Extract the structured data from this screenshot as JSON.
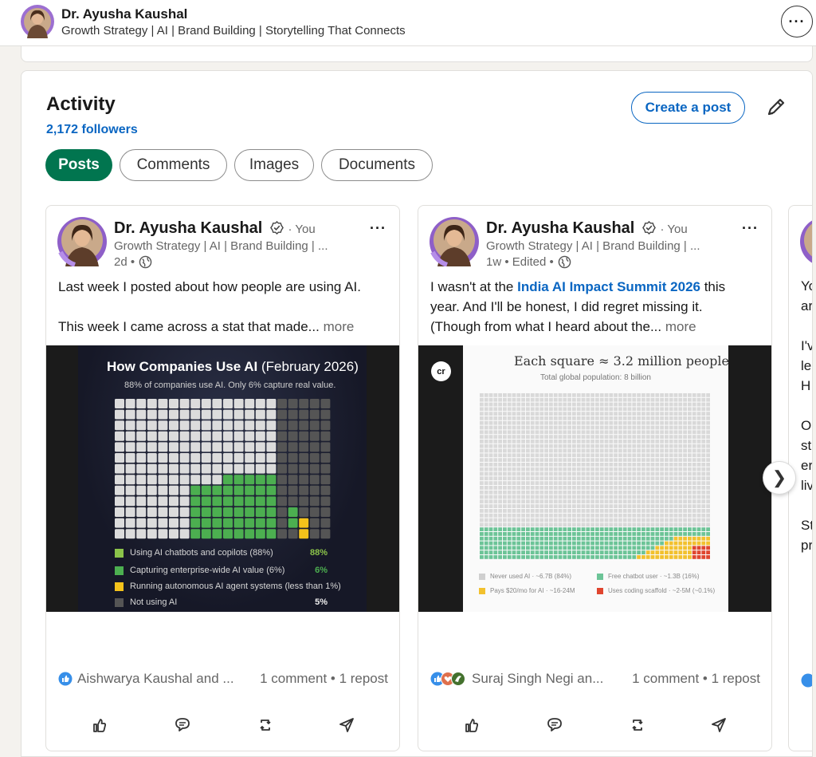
{
  "header": {
    "name": "Dr. Ayusha Kaushal",
    "headline": "Growth Strategy | AI | Brand Building | Storytelling That Connects",
    "more_label": "···"
  },
  "activity": {
    "title": "Activity",
    "followers": "2,172 followers",
    "create_post": "Create a post",
    "tabs": [
      {
        "label": "Posts",
        "active": true
      },
      {
        "label": "Comments",
        "active": false
      },
      {
        "label": "Images",
        "active": false
      },
      {
        "label": "Documents",
        "active": false
      }
    ]
  },
  "posts": [
    {
      "author": "Dr. Ayusha Kaushal",
      "you": "· You",
      "headline": "Growth Strategy | AI | Brand Building | ...",
      "meta": "2d •",
      "menu": "···",
      "text_line1": "Last week I posted about how people are using AI.",
      "text_line2": "This week I came across a stat that made...",
      "more": "more",
      "image": {
        "title": "How Companies Use AI",
        "title_light": "(February 2026)",
        "subtitle": "88% of companies use AI. Only 6% capture real value.",
        "legend": [
          {
            "label": "Using AI chatbots and copilots (88%)",
            "value": "88%",
            "color": "#8bc34a"
          },
          {
            "label": "Capturing enterprise-wide AI value (6%)",
            "value": "6%",
            "color": "#4caf50"
          },
          {
            "label": "Running autonomous AI agent systems (less than 1%)",
            "value": "",
            "color": "#f4c21b"
          },
          {
            "label": "Not using AI",
            "value": "5%",
            "color": "#555555"
          }
        ]
      },
      "reactors": "Aishwarya Kaushal and ...",
      "counts": "1 comment • 1 repost"
    },
    {
      "author": "Dr. Ayusha Kaushal",
      "you": "· You",
      "headline": "Growth Strategy | AI | Brand Building | ...",
      "meta": "1w • Edited •",
      "menu": "···",
      "text_pre": "I wasn't at the ",
      "text_link": "India AI Impact Summit 2026",
      "text_post": " this",
      "text_line2": "year. And I'll be honest, I did regret missing it.",
      "text_line3": "(Though from what I heard about the...",
      "more": "more",
      "image": {
        "badge": "cr",
        "title": "Each square ≈ 3.2 million people",
        "subtitle": "Total global population: 8 billion",
        "legend": [
          {
            "label": "Never used AI · ~6.7B (84%)",
            "color": "#cfcfcf"
          },
          {
            "label": "Free chatbot user · ~1.3B (16%)",
            "color": "#6cc497"
          },
          {
            "label": "Pays $20/mo for AI · ~16-24M",
            "color": "#f2c12e"
          },
          {
            "label": "Uses coding scaffold · ~2-5M (~0.1%)",
            "color": "#e0452f"
          }
        ]
      },
      "reactors": "Suraj Singh Negi an...",
      "counts": "1 comment • 1 repost"
    }
  ],
  "peek_post": {
    "lines": [
      "Yo",
      "ar",
      "I'v",
      "le",
      "H",
      "O",
      "st",
      "er",
      "liv",
      "St",
      "pr"
    ]
  },
  "colors": {
    "brand_blue": "#0a66c2",
    "active_green": "#01754f"
  }
}
